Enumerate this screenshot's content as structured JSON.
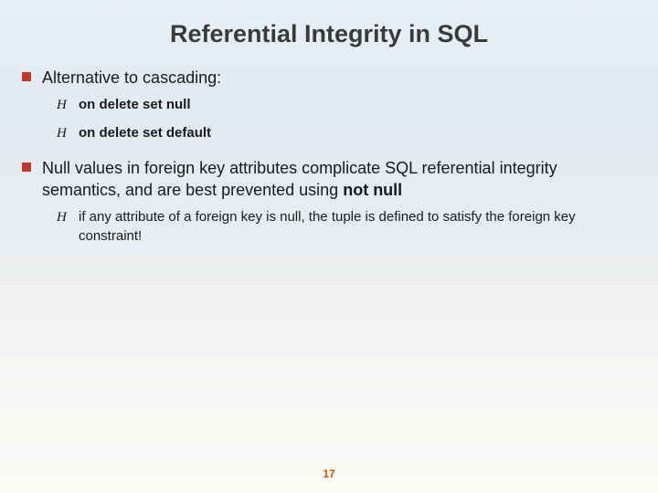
{
  "title": "Referential Integrity in SQL",
  "b1": {
    "text": "Alternative to cascading:",
    "sub1": "on delete set null",
    "sub2": "on delete set default"
  },
  "b2": {
    "t1": "Null values in foreign key attributes complicate SQL referential integrity semantics, and are best prevented using ",
    "t2": "not null",
    "sub1": "if any attribute of a foreign key is null, the tuple is defined to satisfy the foreign key constraint!"
  },
  "pagenum": "17",
  "bullet_glyph": "H"
}
